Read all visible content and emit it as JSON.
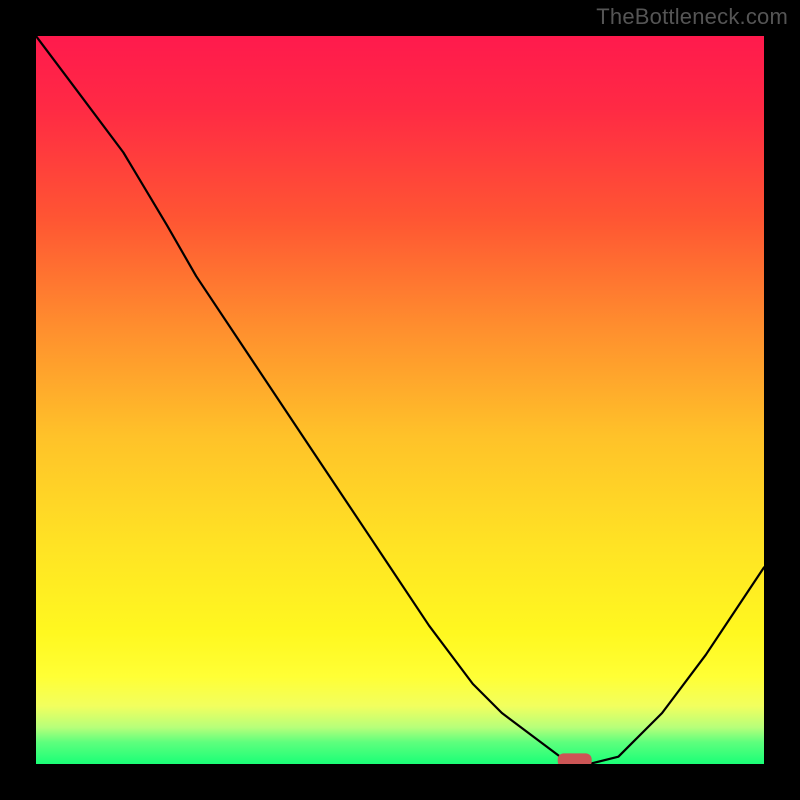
{
  "watermark": "TheBottleneck.com",
  "chart_data": {
    "type": "line",
    "title": "",
    "xlabel": "",
    "ylabel": "",
    "xlim": [
      0,
      100
    ],
    "ylim": [
      0,
      100
    ],
    "grid": false,
    "legend": null,
    "series": [
      {
        "name": "bottleneck-curve",
        "x": [
          0,
          6,
          12,
          18,
          22,
          30,
          38,
          46,
          54,
          60,
          64,
          68,
          72,
          76,
          80,
          86,
          92,
          100
        ],
        "values": [
          100,
          92,
          84,
          74,
          67,
          55,
          43,
          31,
          19,
          11,
          7,
          4,
          1,
          0,
          1,
          7,
          15,
          27
        ]
      }
    ],
    "annotations": [
      {
        "name": "optimal-marker",
        "x": 74,
        "y": 0.5,
        "color": "#cc5555"
      }
    ],
    "gradient_stops": [
      {
        "pct": 0,
        "color": "#ff1a4d"
      },
      {
        "pct": 25,
        "color": "#ff5533"
      },
      {
        "pct": 55,
        "color": "#ffc229"
      },
      {
        "pct": 85,
        "color": "#ffff2e"
      },
      {
        "pct": 100,
        "color": "#1aff77"
      }
    ]
  }
}
